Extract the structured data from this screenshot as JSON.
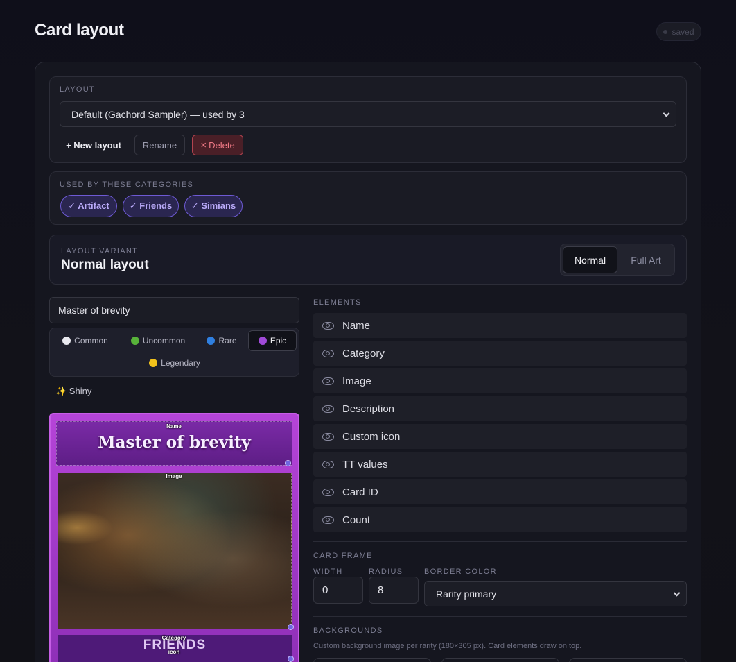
{
  "header": {
    "title": "Card layout",
    "status": "saved"
  },
  "layout_section": {
    "label": "LAYOUT",
    "selected": "Default (Gachord Sampler) — used by 3",
    "new_button": "+ New layout",
    "rename_button": "Rename",
    "delete_button": "Delete"
  },
  "categories_section": {
    "label": "USED BY THESE CATEGORIES",
    "chips": [
      {
        "label": "✓ Artifact"
      },
      {
        "label": "✓ Friends"
      },
      {
        "label": "✓ Simians"
      }
    ]
  },
  "variant_section": {
    "label": "LAYOUT VARIANT",
    "title": "Normal layout",
    "options": [
      "Normal",
      "Full Art"
    ],
    "selected": "Normal"
  },
  "preview": {
    "card_name_input": "Master of brevity",
    "rarities": [
      {
        "label": "Common",
        "color": "#e8e8ee"
      },
      {
        "label": "Uncommon",
        "color": "#58b33a"
      },
      {
        "label": "Rare",
        "color": "#2f7fe0"
      },
      {
        "label": "Epic",
        "color": "#a04ad8"
      },
      {
        "label": "Legendary",
        "color": "#f2c21b"
      }
    ],
    "selected_rarity": "Epic",
    "shiny_label": "✨ Shiny",
    "card": {
      "name_tag": "Name",
      "name_text": "Master of brevity",
      "image_tag": "Image",
      "category_tag": "Category",
      "category_text": "FRIENDS",
      "icon_tag": "icon",
      "accent_color": "#a040d0"
    }
  },
  "elements_section": {
    "label": "ELEMENTS",
    "items": [
      "Name",
      "Category",
      "Image",
      "Description",
      "Custom icon",
      "TT values",
      "Card ID",
      "Count"
    ]
  },
  "card_frame": {
    "label": "CARD FRAME",
    "width_label": "WIDTH",
    "width_value": "0",
    "radius_label": "RADIUS",
    "radius_value": "8",
    "border_color_label": "BORDER COLOR",
    "border_color_value": "Rarity primary"
  },
  "backgrounds": {
    "label": "BACKGROUNDS",
    "hint": "Custom background image per rarity (180×305 px). Card elements draw on top."
  }
}
